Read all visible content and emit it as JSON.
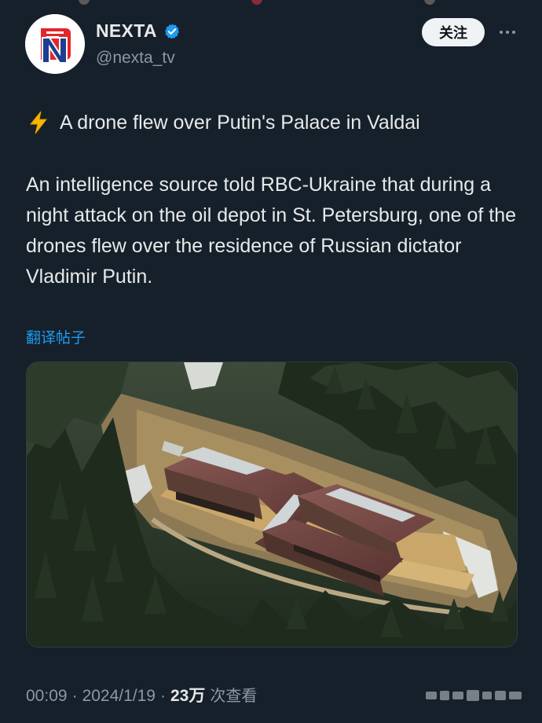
{
  "author": {
    "display_name": "NEXTA",
    "handle": "@nexta_tv",
    "verified": true,
    "avatar_letter": "N"
  },
  "actions": {
    "follow_label": "关注",
    "more_icon": "more-dots-icon"
  },
  "post": {
    "headline_icon": "lightning-bolt-icon",
    "headline": "A drone flew over Putin's Palace in Valdai",
    "body": "An intelligence source told RBC-Ukraine that during a night attack on the oil depot in St. Petersburg, one of the drones flew over the residence of Russian dictator Vladimir Putin.",
    "translate_label": "翻译帖子"
  },
  "media": {
    "kind": "aerial photo of a large brown-roofed building in a forest clearing"
  },
  "meta": {
    "time": "00:09",
    "date": "2024/1/19",
    "views_count": "23万",
    "views_label": "次查看"
  },
  "colors": {
    "background": "#15202b",
    "accent": "#1d9bf0",
    "text_primary": "#e7e9ea",
    "text_secondary": "#8b98a5",
    "verified": "#1d9bf0"
  }
}
